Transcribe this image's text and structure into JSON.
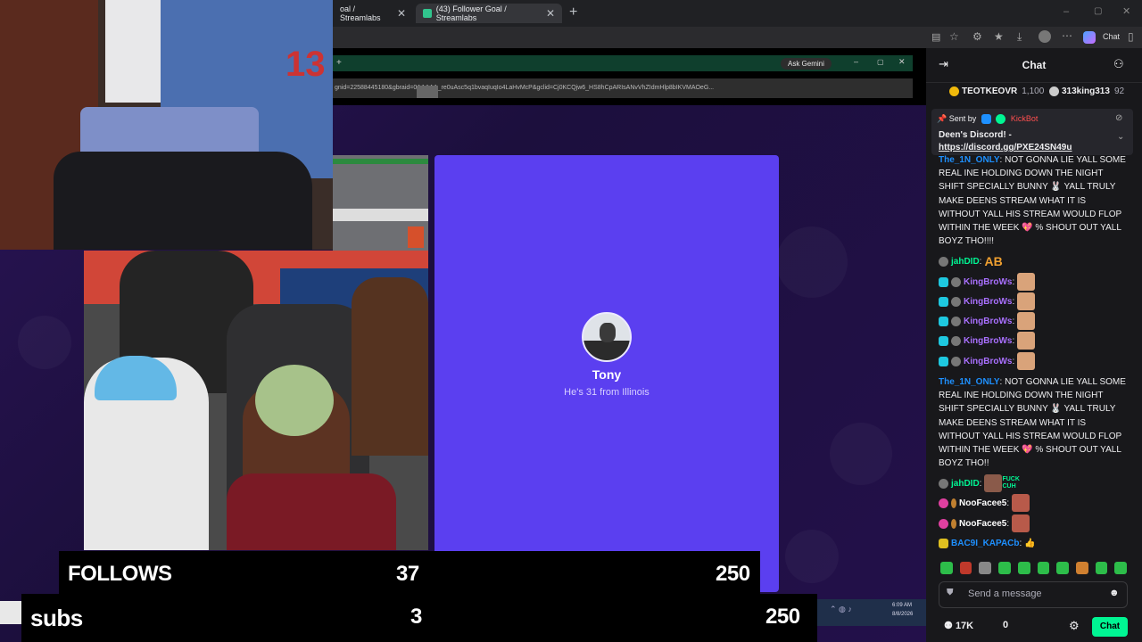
{
  "browser": {
    "tabs": [
      {
        "label": "oal / Streamlabs"
      },
      {
        "label": "(43) Follower Goal / Streamlabs"
      }
    ],
    "chat_button": "Chat"
  },
  "inner_browser": {
    "gemini": "Ask Gemini",
    "url": "gnid=22588445180&gbraid=0AAAAA_re0uAsc5q1bvaqIuqIo4LaHvMcP&gclid=Cj0KCQjw6_HS8hCpARIsANvVhZIdmHlp8bIKVMAOeG..."
  },
  "card": {
    "name": "Tony",
    "description": "He's 31 from Illinois"
  },
  "goals": {
    "follows": {
      "label": "FOLLOWS",
      "current": "37",
      "target": "250"
    },
    "subs": {
      "label": "subs",
      "current": "3",
      "target": "250"
    }
  },
  "taskbar": {
    "time": "6:09 AM",
    "date": "8/8/2026"
  },
  "chat": {
    "title": "Chat",
    "leaders": [
      {
        "name": "TEOTKEOVR",
        "score": "1,100"
      },
      {
        "name": "313king313",
        "score": "92"
      }
    ],
    "pinned": {
      "sent_by": "Sent by",
      "bot": "KickBot",
      "text": "Deen's Discord! -",
      "link": "https://discord.gg/PXE24SN49u"
    },
    "long_message_user": "The_1N_ONLY",
    "long_message_text": ": NOT GONNA LIE YALL SOME REAL INE HOLDING DOWN THE NIGHT SHIFT SPECIALLY BUNNY 🐰 YALL TRULY MAKE DEENS STREAM WHAT IT IS WITHOUT YALL HIS STREAM WOULD FLOP WITHIN THE WEEK 💖 % SHOUT OUT YALL BOYZ THO!!!!",
    "long_message_text2": ": NOT GONNA LIE YALL SOME REAL INE HOLDING DOWN THE NIGHT SHIFT SPECIALLY BUNNY 🐰 YALL TRULY MAKE DEENS STREAM WHAT IT IS WITHOUT YALL HIS STREAM WOULD FLOP WITHIN THE WEEK 💖 % SHOUT OUT YALL BOYZ THO!!",
    "jahdid": "jahDID",
    "jahdid_text": "AB",
    "kingbrows": "KingBroWs",
    "noofacees": "NooFacee5",
    "bacgi": "BAC9I_KAPACb",
    "emote_text": "FUCK CUH",
    "input_placeholder": "Send a message",
    "viewers": "17K",
    "points": "0",
    "send_button": "Chat",
    "colors": {
      "green": "#00f593",
      "purple": "#a970ff",
      "blue": "#1e90ff"
    }
  }
}
